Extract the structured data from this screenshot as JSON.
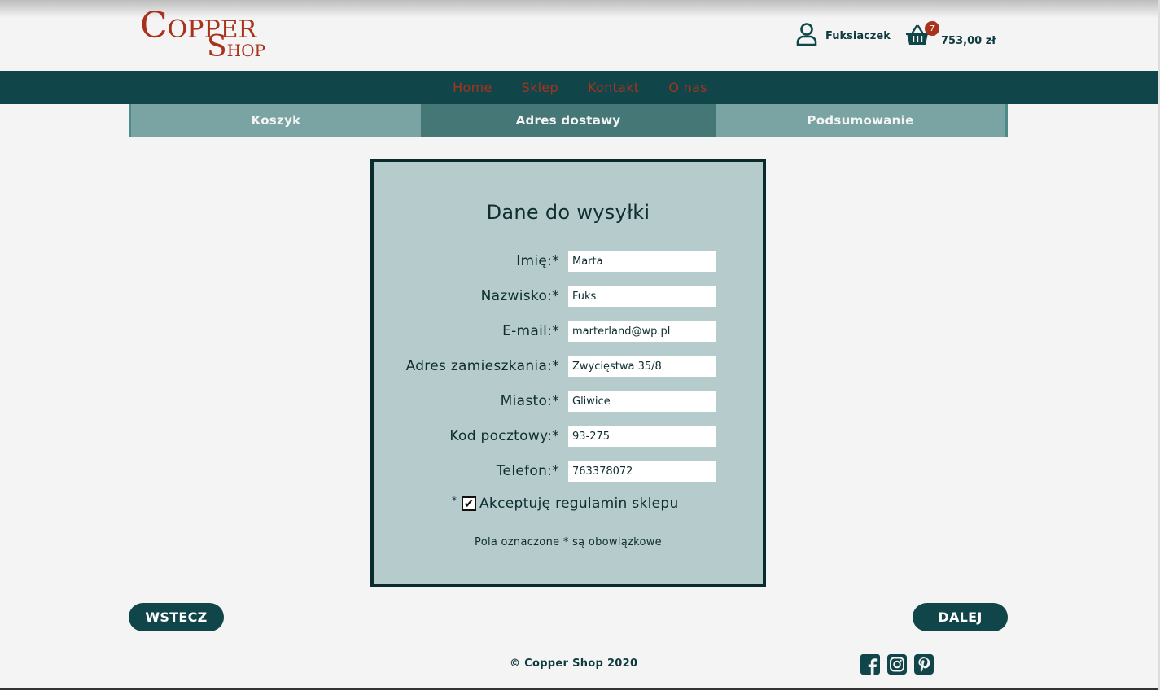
{
  "brand": {
    "word1": "Copper",
    "word2": "Shop",
    "color": "#a8321c"
  },
  "user": {
    "name": "Fuksiaczek",
    "icon": "user-icon"
  },
  "cart": {
    "count": "7",
    "total": "753,00 zł",
    "icon": "basket-icon"
  },
  "nav": {
    "items": [
      "Home",
      "Sklep",
      "Kontakt",
      "O nas"
    ]
  },
  "steps": {
    "items": [
      "Koszyk",
      "Adres dostawy",
      "Podsumowanie"
    ],
    "active": "Adres dostawy"
  },
  "form": {
    "title": "Dane do wysyłki",
    "fields": [
      {
        "label": "Imię:*",
        "value": "Marta"
      },
      {
        "label": "Nazwisko:*",
        "value": "Fuks"
      },
      {
        "label": "E-mail:*",
        "value": "marterland@wp.pl"
      },
      {
        "label": "Adres zamieszkania:*",
        "value": "Zwycięstwa 35/8"
      },
      {
        "label": "Miasto:*",
        "value": "Gliwice"
      },
      {
        "label": "Kod pocztowy:*",
        "value": "93-275"
      },
      {
        "label": "Telefon:*",
        "value": "763378072"
      }
    ],
    "accept_star": "*",
    "accept_label": "Akceptuję regulamin sklepu",
    "accept_checked": true,
    "note": "Pola oznaczone * są obowiązkowe"
  },
  "buttons": {
    "back": "WSTECZ",
    "next": "DALEJ"
  },
  "footer": {
    "copyright": "© Copper Shop 2020",
    "social_icons": [
      "facebook-icon",
      "instagram-icon",
      "pinterest-icon"
    ]
  },
  "colors": {
    "primary": "#10464a",
    "accent": "#a8321c",
    "panel": "#b6cbcc"
  }
}
